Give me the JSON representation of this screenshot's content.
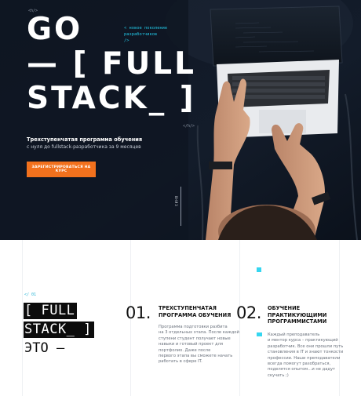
{
  "hero": {
    "tag_open": "<h/>",
    "title_lines": [
      "GO",
      "— [ FULL",
      "STACK_ ]"
    ],
    "tag_close": "</h/>",
    "code_note": [
      "< новое поколение",
      "разработчиков",
      "/>"
    ],
    "subtitle": "Трехступенчатая программа обучения",
    "description": "с нуля до fullstack-разработчика за 9 месяцев",
    "cta_label": "ЗАРЕГИСТРИРОВАТЬСЯ НА КУРС",
    "vertical_text": "ВНИЗ"
  },
  "about": {
    "section_tag": "</ 01",
    "brand_lines": [
      "[ FULL",
      "STACK_ ]"
    ],
    "brand_tail": "ЭТО —"
  },
  "features": [
    {
      "number": "01.",
      "title": [
        "ТРЕХСТУПЕНЧАТАЯ",
        "ПРОГРАММА ОБУЧЕНИЯ"
      ],
      "text": [
        "Программа подготовки разбита",
        "на 3 отдельных этапа. После каждой",
        "ступени студент получает новые",
        "навыки и готовый проект для",
        "портфолио. Даже после",
        "первого этапа вы сможете начать",
        "работать в сфере IT."
      ]
    },
    {
      "number": "02.",
      "title": [
        "ОБУЧЕНИЕ",
        "ПРАКТИКУЮЩИМИ",
        "ПРОГРАММИСТАМИ"
      ],
      "text": [
        "Каждый преподаватель",
        "и ментор курса – практикующий",
        "разработчик. Все они прошли путь",
        "становления в IT и знают тонкости",
        "профессии. Наши преподаватели",
        "всегда помогут разобраться,",
        "поделятся опытом…и не дадут",
        "скучать ;)"
      ]
    }
  ],
  "colors": {
    "hero_bg": "#0f1622",
    "accent_orange": "#f2711d",
    "accent_cyan": "#22c7e6"
  }
}
